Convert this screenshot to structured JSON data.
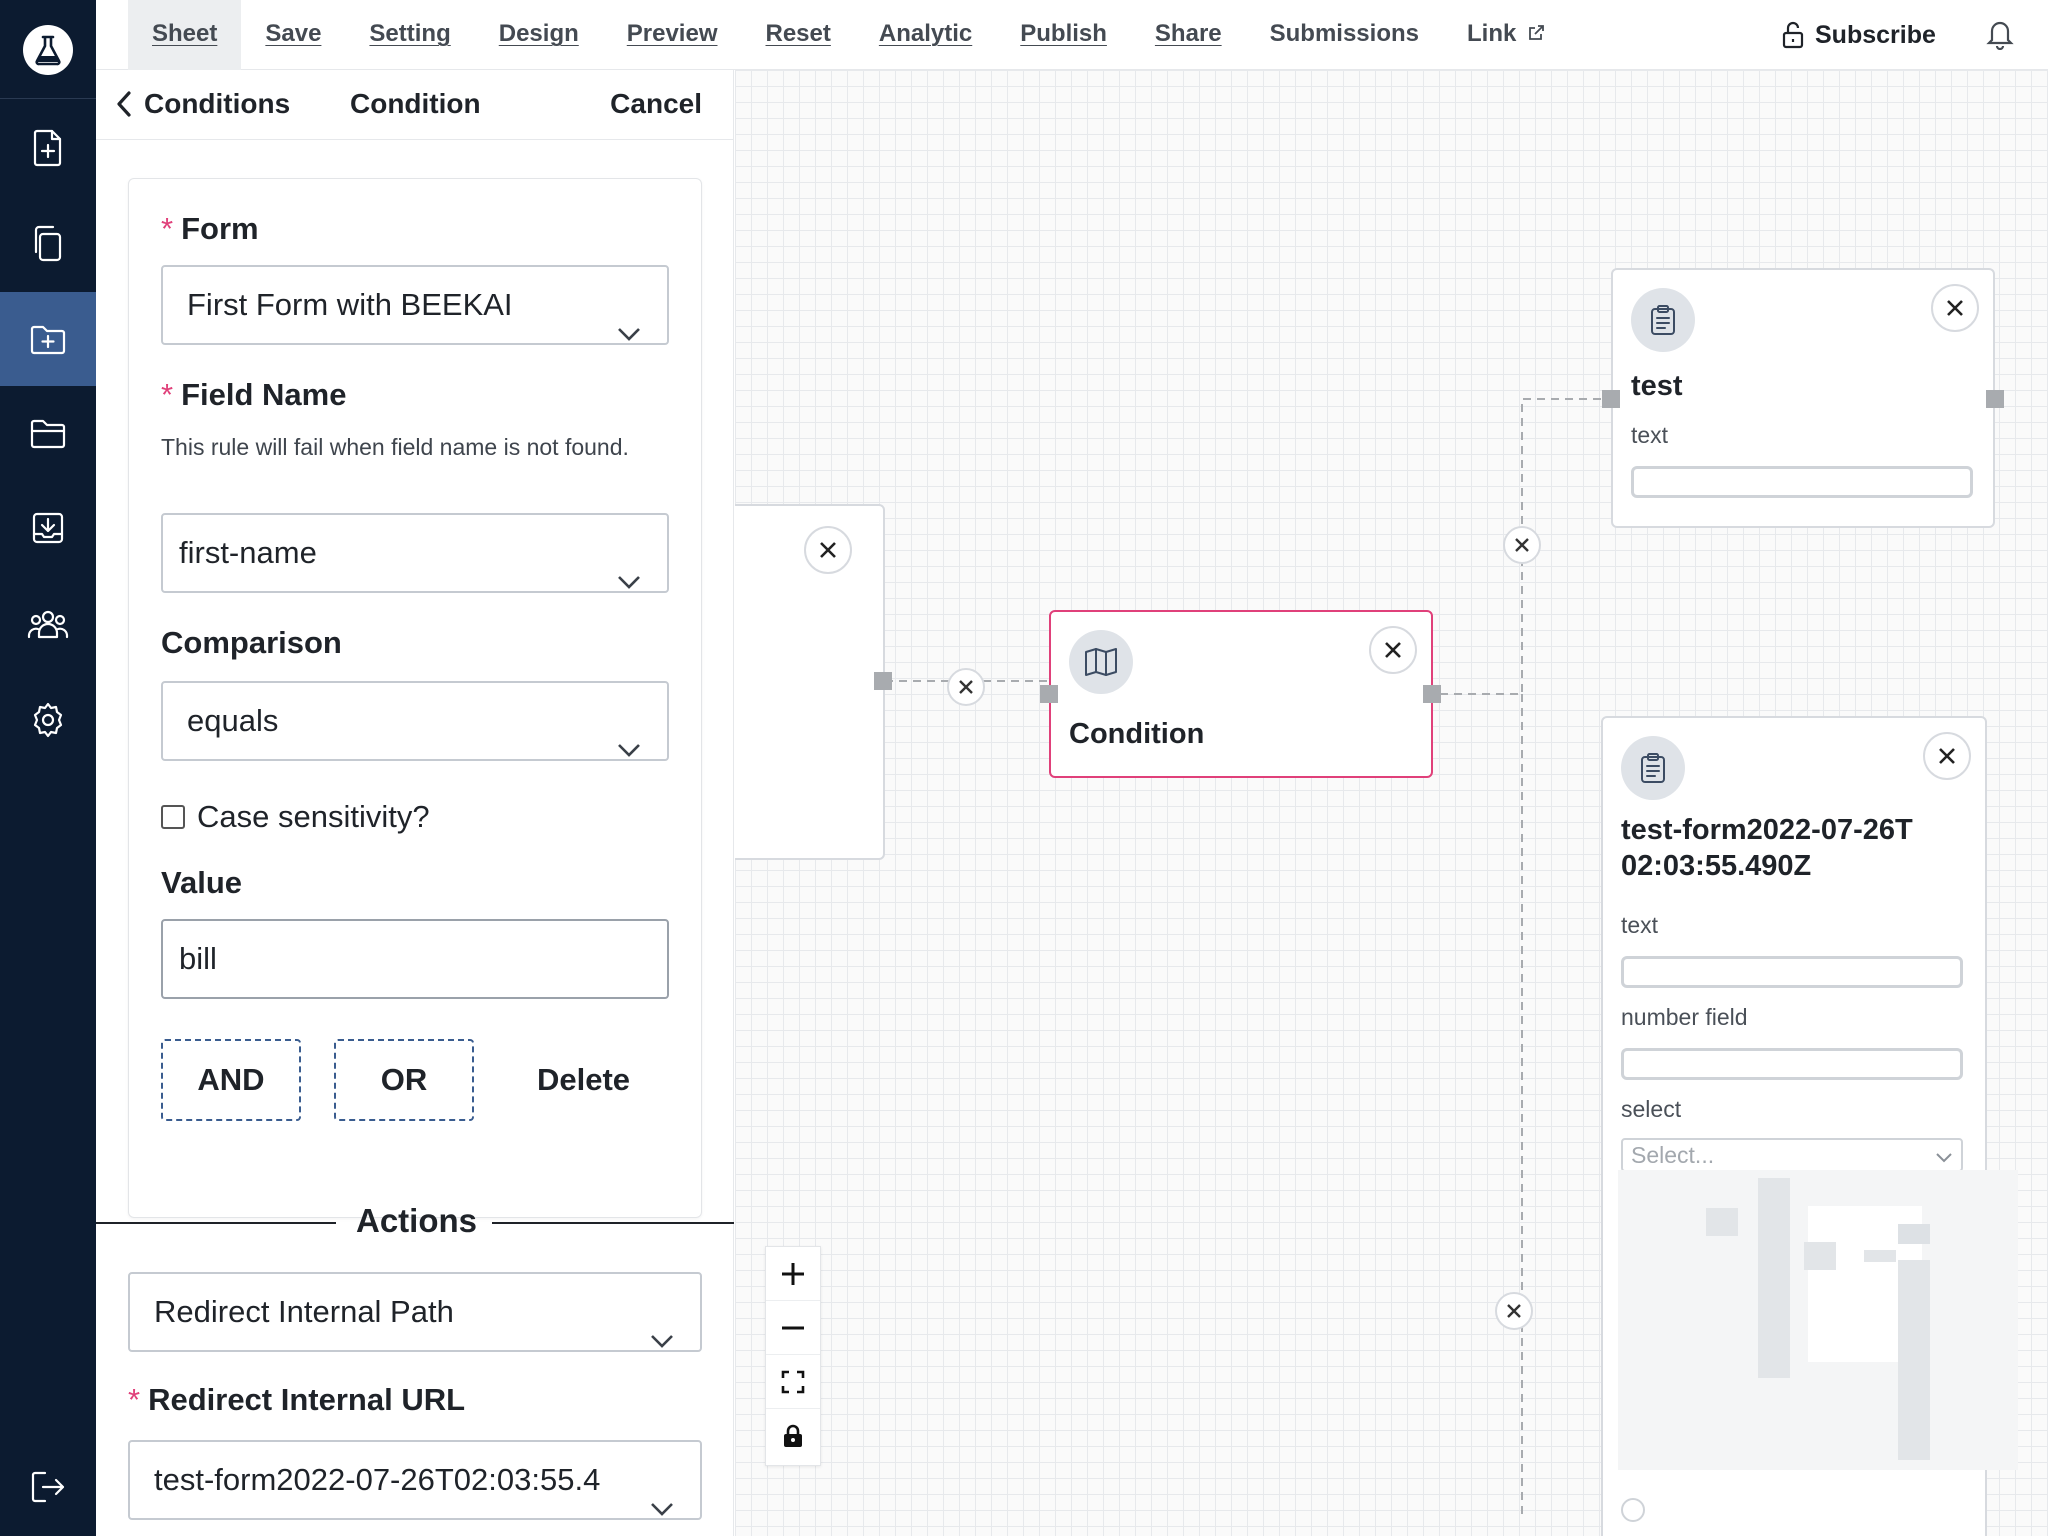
{
  "menu": {
    "items": [
      "Sheet",
      "Save",
      "Setting",
      "Design",
      "Preview",
      "Reset",
      "Analytic",
      "Publish",
      "Share",
      "Submissions",
      "Link"
    ],
    "active": "Sheet",
    "subscribe_label": "Subscribe"
  },
  "panel": {
    "back_label": "Conditions",
    "title": "Condition",
    "cancel_label": "Cancel",
    "form_label": "Form",
    "form_value": "First Form with BEEKAI",
    "field_name_label": "Field Name",
    "field_name_help": "This rule will fail when field name is not found.",
    "field_name_value": "first-name",
    "comparison_label": "Comparison",
    "comparison_value": "equals",
    "case_label": "Case sensitivity?",
    "value_label": "Value",
    "value_value": "bill",
    "and_label": "AND",
    "or_label": "OR",
    "delete_label": "Delete",
    "actions_label": "Actions",
    "action_type_value": "Redirect Internal Path",
    "redirect_url_label": "Redirect Internal URL",
    "redirect_url_value": "test-form2022-07-26T02:03:55.4"
  },
  "canvas": {
    "condition_node": {
      "title": "Condition"
    },
    "test_node": {
      "title": "test",
      "field_label": "text"
    },
    "form_node": {
      "title": "test-form2022-07-26T02:03:55.490Z",
      "fields": [
        "text",
        "number field",
        "select"
      ],
      "select_placeholder": "Select..."
    }
  },
  "colors": {
    "rail_bg": "#0c1b30",
    "rail_active": "#3a5c8f",
    "required": "#e0407a",
    "selected_border": "#e0407a"
  }
}
